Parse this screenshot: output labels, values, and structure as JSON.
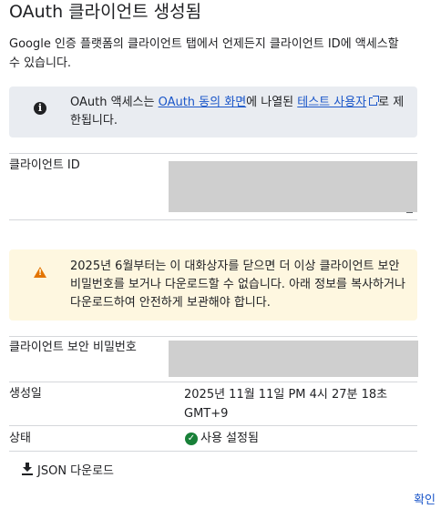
{
  "dialog": {
    "title": "OAuth 클라이언트 생성됨",
    "description": "Google 인증 플랫폼의 클라이언트 탭에서 언제든지 클라이언트 ID에 액세스할 수 있습니다."
  },
  "info": {
    "icon": "info-icon",
    "text_1": "OAuth 액세스는 ",
    "link_consent": "OAuth 동의 화면",
    "text_2": "에 나열된 ",
    "link_testers": "테스트 사용자",
    "text_3": "로 제한됩니다.",
    "external_icon": "open-in-new-icon"
  },
  "client_id": {
    "label": "클라이언트 ID"
  },
  "warning": {
    "icon": "warning-icon",
    "text": "2025년 6월부터는 이 대화상자를 닫으면 더 이상 클라이언트 보안 비밀번호를 보거나 다운로드할 수 없습니다. 아래 정보를 복사하거나 다운로드하여 안전하게 보관해야 합니다."
  },
  "client_secret": {
    "label": "클라이언트 보안 비밀번호"
  },
  "created": {
    "label": "생성일",
    "value": "2025년 11월 11일 PM 4시 27분 18초 GMT+9"
  },
  "status": {
    "label": "상태",
    "icon": "check-circle-icon",
    "value": "사용 설정됨"
  },
  "actions": {
    "download_label": "JSON 다운로드",
    "download_icon": "download-icon",
    "confirm_label": "확인"
  },
  "colors": {
    "link": "#1a56c9",
    "info_bg": "#e9ecf1",
    "warning_bg": "#fef7e0",
    "warning_icon": "#e37400",
    "success": "#188038"
  }
}
